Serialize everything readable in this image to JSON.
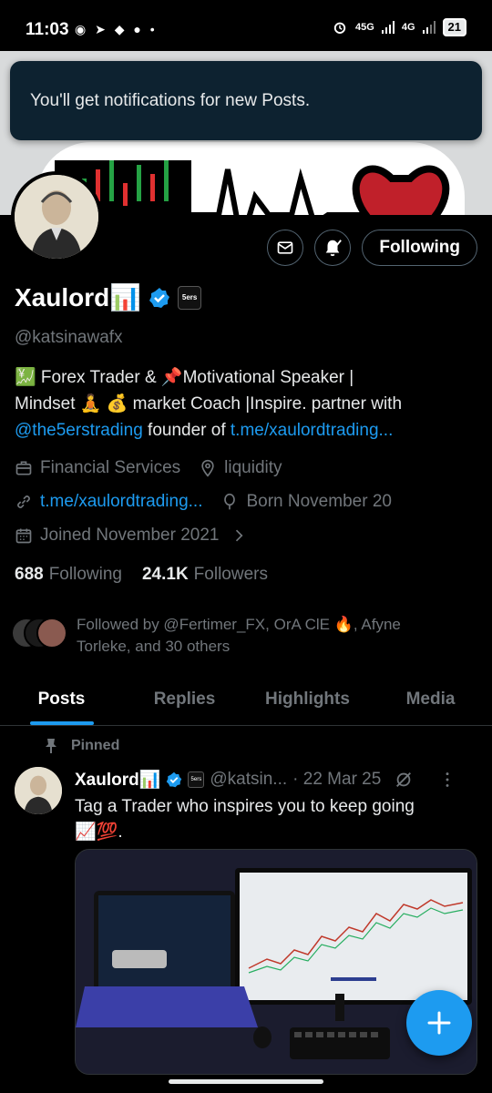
{
  "status_bar": {
    "time": "11:03",
    "left_icons": "◉ ➤ ◆ ● •",
    "network": "45G",
    "network2": "4G",
    "battery": "21"
  },
  "toast": {
    "message": "You'll get notifications for new Posts."
  },
  "profile": {
    "display_name": "Xaulord📊",
    "handle": "@katsinawafx",
    "following_label": "Following",
    "bio_line1": "💹 Forex Trader & 📌Motivational Speaker |",
    "bio_line2": "Mindset 🧘 💰 market Coach |Inspire. partner with",
    "bio_mention": "@the5erstrading",
    "bio_founder": " founder of ",
    "bio_link": "t.me/xaulordtrading...",
    "category": "Financial Services",
    "location": "liquidity",
    "website": "t.me/xaulordtrading...",
    "born": "Born November 20",
    "joined": "Joined November 2021",
    "following_count": "688",
    "following_text": "Following",
    "followers_count": "24.1K",
    "followers_text": "Followers",
    "followed_by_line1": "Followed by @Fertimer_FX, OrA ClE 🔥, Afyne",
    "followed_by_line2": "Torleke, and 30 others"
  },
  "tabs": [
    {
      "label": "Posts"
    },
    {
      "label": "Replies"
    },
    {
      "label": "Highlights"
    },
    {
      "label": "Media"
    }
  ],
  "pinned_post": {
    "pinned_label": "Pinned",
    "name": "Xaulord📊",
    "handle": "@katsin...",
    "date": "· 22 Mar 25",
    "text_line1": "Tag a Trader who inspires you to keep going",
    "text_line2": "📈💯."
  },
  "colors": {
    "accent": "#1d9bf0",
    "background": "#000000",
    "muted": "#71767b",
    "toast_bg": "#0d2230"
  }
}
